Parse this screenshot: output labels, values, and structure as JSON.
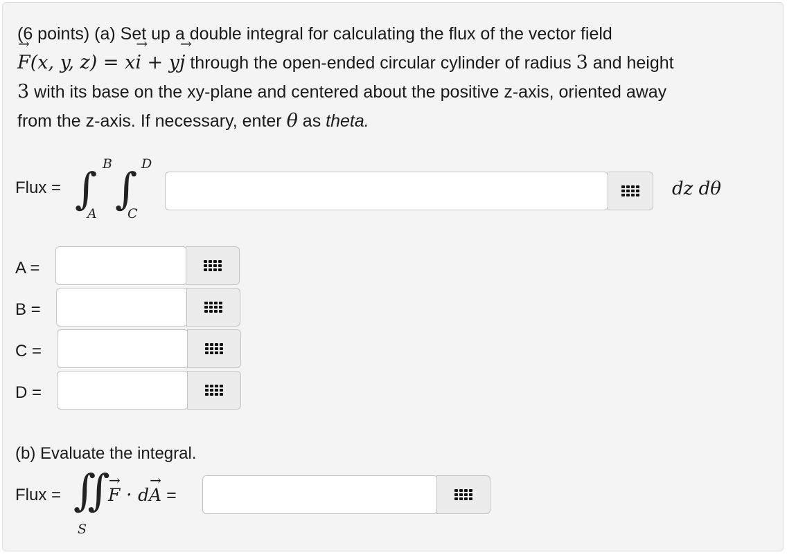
{
  "part_a": {
    "intro": "(6 points) (a) Set up a double integral for calculating the flux of the vector field",
    "field_expr": "F(x, y, z) = xi + yj",
    "line2_rest": "through the open-ended circular cylinder of radius",
    "radius": "3",
    "line2_end": "and height",
    "height": "3",
    "line3": "with its base on the xy-plane and centered about the positive z-axis, oriented away",
    "line4_start": "from the z-axis. If necessary, enter",
    "theta_symbol": "θ",
    "line4_as": "as",
    "theta_word": "theta."
  },
  "flux_a": {
    "label": "Flux =",
    "outer_lower": "A",
    "outer_upper": "B",
    "inner_lower": "C",
    "inner_upper": "D",
    "integral_symbol": "∫",
    "input_value": "",
    "differential": "dz dθ"
  },
  "bounds": [
    {
      "label": "A =",
      "value": ""
    },
    {
      "label": "B =",
      "value": ""
    },
    {
      "label": "C =",
      "value": ""
    },
    {
      "label": "D =",
      "value": ""
    }
  ],
  "part_b": {
    "prompt": "(b) Evaluate the integral.",
    "label": "Flux =",
    "integral_symbol": "∬",
    "surface": "S",
    "integrand": "F · dA =",
    "input_value": ""
  },
  "icons": {
    "keypad": "keypad-grid-icon"
  },
  "colors": {
    "card_bg": "#f4f4f4",
    "border": "#c4c4c4",
    "keypad_bg": "#ececec"
  }
}
